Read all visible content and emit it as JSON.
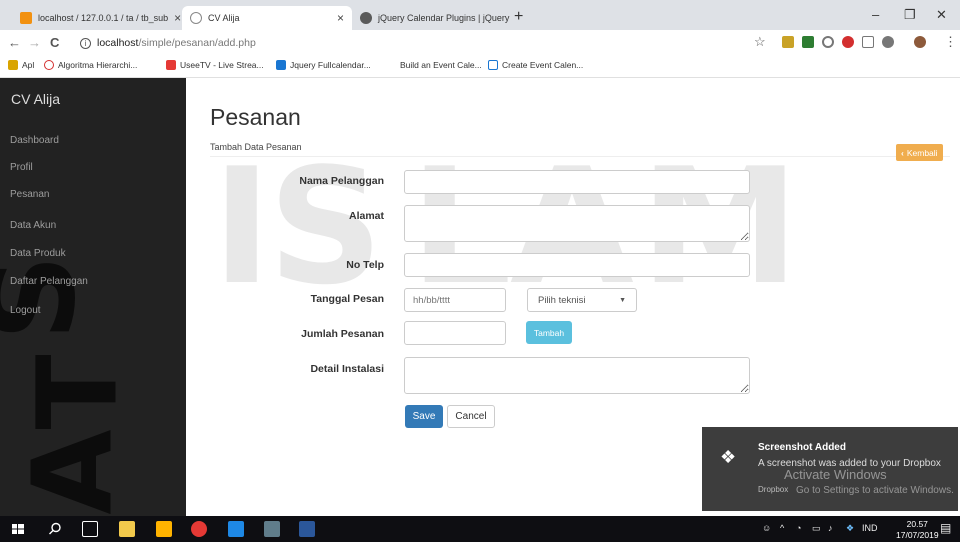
{
  "browser": {
    "tabs": [
      {
        "title": "localhost / 127.0.0.1 / ta / tb_sub",
        "close": "×"
      },
      {
        "title": "CV Alija",
        "close": "×"
      },
      {
        "title": "jQuery Calendar Plugins | jQuery",
        "close": "×"
      }
    ],
    "new_tab": "+",
    "window": {
      "minimize": "–",
      "maximize": "❐",
      "close": "✕"
    },
    "nav": {
      "back": "←",
      "forward": "→",
      "reload": "C"
    },
    "url": {
      "host": "localhost",
      "path": "/simple/pesanan/add.php",
      "star": "☆",
      "menu": "⋮"
    },
    "bookmarks": [
      "Apl",
      "Algoritma Hierarchi...",
      "UseeTV - Live Strea...",
      "Jquery Fullcalendar...",
      "Build an Event Cale...",
      "Create Event Calen..."
    ]
  },
  "sidebar": {
    "brand": "CV Alija",
    "items": [
      "Dashboard",
      "Profil",
      "Pesanan",
      "Data Akun",
      "Data Produk",
      "Daftar Pelanggan",
      "Logout"
    ]
  },
  "main": {
    "title": "Pesanan",
    "subtitle": "Tambah Data Pesanan",
    "back_button": "Kembali",
    "form": {
      "nama_label": "Nama Pelanggan",
      "alamat_label": "Alamat",
      "telp_label": "No Telp",
      "tanggal_label": "Tanggal Pesan",
      "tanggal_placeholder": "hh/bb/tttt",
      "teknisi_select": "Pilih teknisi",
      "jumlah_label": "Jumlah Pesanan",
      "tambah_button": "Tambah",
      "detail_label": "Detail Instalasi",
      "save_button": "Save",
      "cancel_button": "Cancel"
    }
  },
  "watermark": {
    "letters": [
      "I",
      "S",
      "L",
      "A",
      "M"
    ],
    "side_letters": [
      "S",
      "T",
      "A"
    ]
  },
  "notification": {
    "title": "Screenshot Added",
    "message": "A screenshot was added to your Dropbox",
    "app": "Dropbox",
    "activate_title": "Activate Windows",
    "activate_sub": "Go to Settings to activate Windows."
  },
  "taskbar": {
    "lang": "IND",
    "time": "20.57",
    "date": "17/07/2019"
  },
  "colors": {
    "sidebar": "#222222",
    "primary": "#337ab7",
    "info": "#5bc0de",
    "warning": "#f0ad4e"
  }
}
